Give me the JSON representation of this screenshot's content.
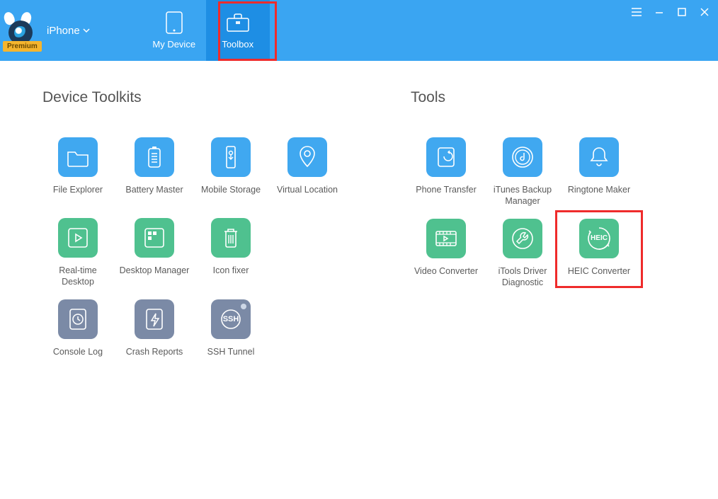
{
  "header": {
    "premium_label": "Premium",
    "device_label": "iPhone",
    "tabs": {
      "my_device": "My Device",
      "toolbox": "Toolbox"
    }
  },
  "sections": {
    "device_toolkits_title": "Device Toolkits",
    "tools_title": "Tools"
  },
  "device_toolkits": {
    "file_explorer": "File Explorer",
    "battery_master": "Battery Master",
    "mobile_storage": "Mobile Storage",
    "virtual_location": "Virtual Location",
    "realtime_desktop": "Real-time Desktop",
    "desktop_manager": "Desktop Manager",
    "icon_fixer": "Icon fixer",
    "console_log": "Console Log",
    "crash_reports": "Crash Reports",
    "ssh_tunnel": "SSH Tunnel"
  },
  "tools": {
    "phone_transfer": "Phone Transfer",
    "itunes_backup": "iTunes Backup Manager",
    "ringtone_maker": "Ringtone Maker",
    "video_converter": "Video Converter",
    "driver_diag": "iTools Driver Diagnostic",
    "heic_converter": "HEIC Converter"
  },
  "icon_text": {
    "ssh": "SSH",
    "heic": "HEIC"
  },
  "colors": {
    "header_bg": "#3aa5f2",
    "header_active": "#1e8ee4",
    "highlight_red": "#ef2b2b",
    "icon_blue": "#40a8f0",
    "icon_green": "#4fc18f",
    "icon_slate": "#7b8aa6",
    "premium_bg": "#f5b52e"
  }
}
